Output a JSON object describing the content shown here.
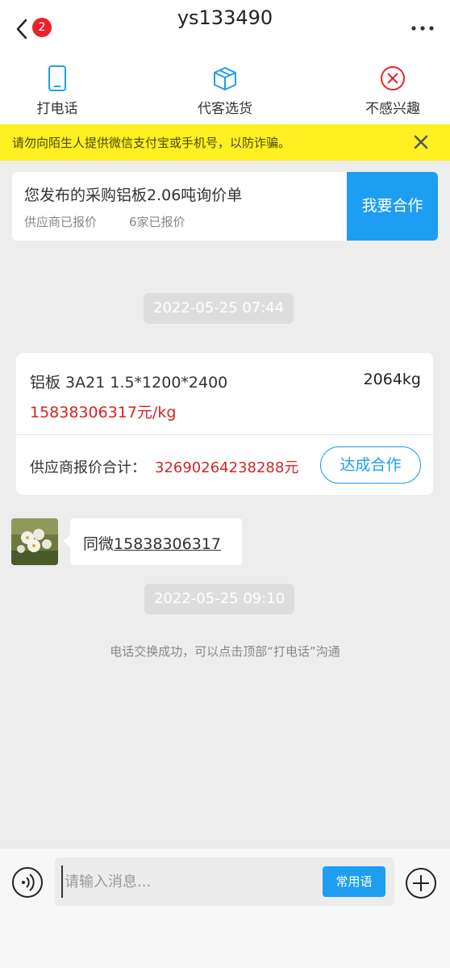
{
  "header": {
    "badge_count": "2",
    "title": "ys133490"
  },
  "actions": [
    {
      "label": "打电话",
      "icon": "phone-icon"
    },
    {
      "label": "代客选货",
      "icon": "box-icon"
    },
    {
      "label": "不感兴趣",
      "icon": "close-circle-icon"
    }
  ],
  "warning": {
    "text": "请勿向陌生人提供微信支付宝或手机号，以防诈骗。"
  },
  "purchase": {
    "title": "您发布的采购铝板2.06吨询价单",
    "sub1": "供应商已报价",
    "sub2": "6家已报价",
    "button": "我要合作"
  },
  "messages": {
    "time1": "2022-05-25 07:44",
    "time2": "2022-05-25 09:10",
    "quote": {
      "product": "铝板 3A21 1.5*1200*2400",
      "weight": "2064kg",
      "price": "15838306317元/kg",
      "total_label": "供应商报价合计：",
      "total_value": "32690264238288元",
      "button": "达成合作"
    },
    "bubble_prefix": "同微",
    "bubble_number": "15838306317",
    "system": "电话交换成功，可以点击顶部“打电话”沟通"
  },
  "input": {
    "placeholder": "请输入消息...",
    "phrase_button": "常用语"
  },
  "colors": {
    "accent": "#1e9ef0",
    "warning_bg": "#fff022",
    "price_red": "#d62424",
    "badge_red": "#e8242a"
  }
}
